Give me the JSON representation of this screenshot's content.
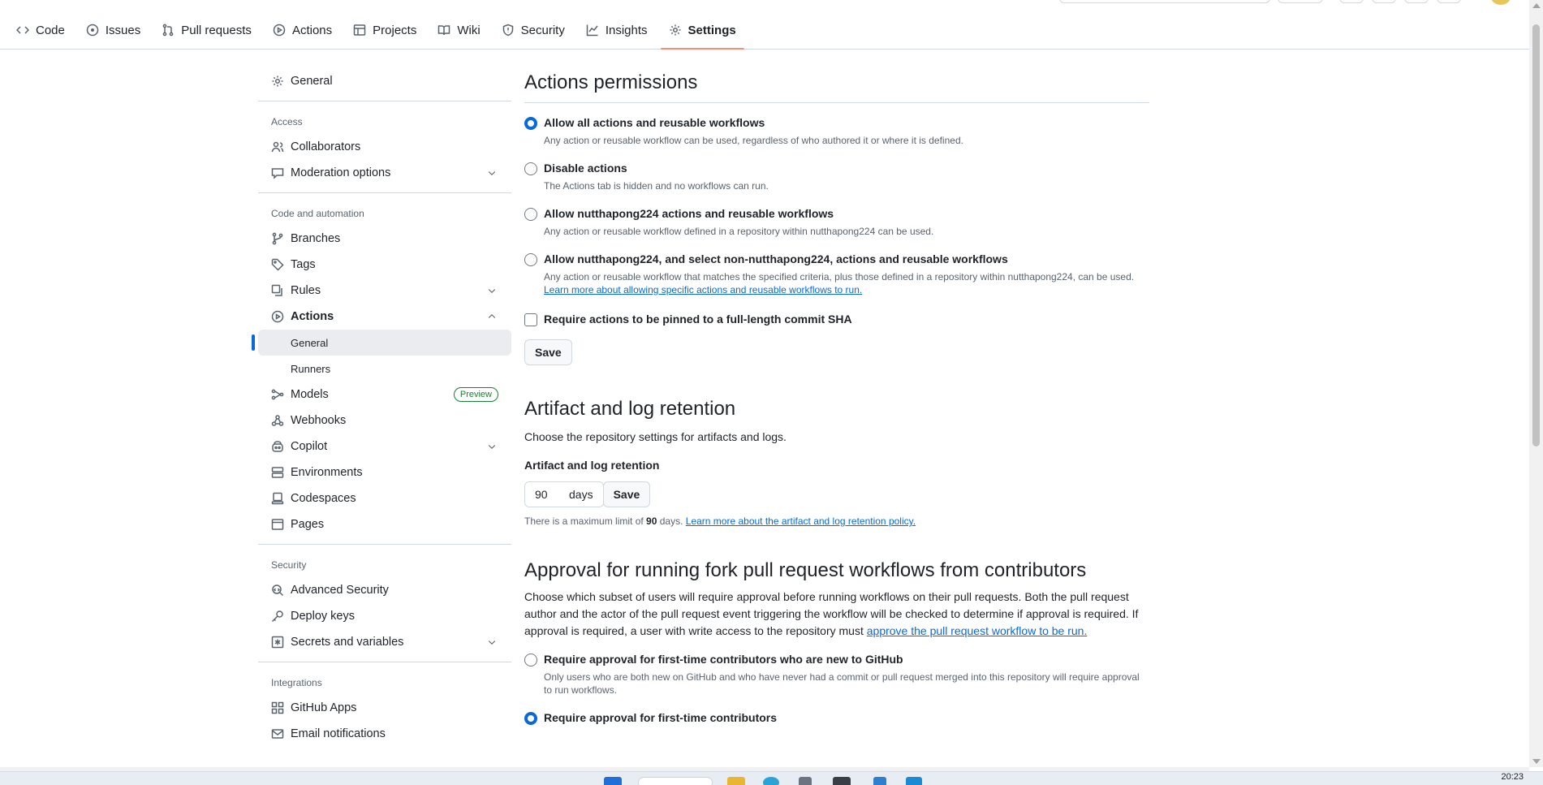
{
  "repo_nav": {
    "tabs": [
      {
        "label": "Code",
        "icon": "code-icon"
      },
      {
        "label": "Issues",
        "icon": "issue-icon"
      },
      {
        "label": "Pull requests",
        "icon": "pull-request-icon"
      },
      {
        "label": "Actions",
        "icon": "play-icon"
      },
      {
        "label": "Projects",
        "icon": "table-icon"
      },
      {
        "label": "Wiki",
        "icon": "book-icon"
      },
      {
        "label": "Security",
        "icon": "shield-icon"
      },
      {
        "label": "Insights",
        "icon": "graph-icon"
      },
      {
        "label": "Settings",
        "icon": "gear-icon",
        "active": true
      }
    ]
  },
  "sidebar": {
    "general": "General",
    "access_heading": "Access",
    "collaborators": "Collaborators",
    "moderation": "Moderation options",
    "code_heading": "Code and automation",
    "branches": "Branches",
    "tags": "Tags",
    "rules": "Rules",
    "actions": "Actions",
    "actions_general": "General",
    "actions_runners": "Runners",
    "models": "Models",
    "models_badge": "Preview",
    "webhooks": "Webhooks",
    "copilot": "Copilot",
    "environments": "Environments",
    "codespaces": "Codespaces",
    "pages": "Pages",
    "security_heading": "Security",
    "advanced_security": "Advanced Security",
    "deploy_keys": "Deploy keys",
    "secrets": "Secrets and variables",
    "integrations_heading": "Integrations",
    "github_apps": "GitHub Apps",
    "email_notifications": "Email notifications"
  },
  "permissions": {
    "title": "Actions permissions",
    "options": [
      {
        "title": "Allow all actions and reusable workflows",
        "desc": "Any action or reusable workflow can be used, regardless of who authored it or where it is defined.",
        "checked": true
      },
      {
        "title": "Disable actions",
        "desc": "The Actions tab is hidden and no workflows can run.",
        "checked": false
      },
      {
        "title": "Allow nutthapong224 actions and reusable workflows",
        "desc": "Any action or reusable workflow defined in a repository within nutthapong224 can be used.",
        "checked": false
      },
      {
        "title": "Allow nutthapong224, and select non-nutthapong224, actions and reusable workflows",
        "desc": "Any action or reusable workflow that matches the specified criteria, plus those defined in a repository within nutthapong224, can be used.",
        "link": "Learn more about allowing specific actions and reusable workflows to run.",
        "checked": false
      }
    ],
    "require_sha": "Require actions to be pinned to a full-length commit SHA",
    "save": "Save"
  },
  "retention": {
    "title": "Artifact and log retention",
    "desc": "Choose the repository settings for artifacts and logs.",
    "label": "Artifact and log retention",
    "value": "90",
    "unit": "days",
    "save": "Save",
    "note_prefix": "There is a maximum limit of",
    "note_value": "90",
    "note_suffix": "days.",
    "note_link": "Learn more about the artifact and log retention policy."
  },
  "approval": {
    "title": "Approval for running fork pull request workflows from contributors",
    "desc": "Choose which subset of users will require approval before running workflows on their pull requests. Both the pull request author and the actor of the pull request event triggering the workflow will be checked to determine if approval is required. If approval is required, a user with write access to the repository must",
    "desc_link": "approve the pull request workflow to be run.",
    "options": [
      {
        "title": "Require approval for first-time contributors who are new to GitHub",
        "desc": "Only users who are both new on GitHub and who have never had a commit or pull request merged into this repository will require approval to run workflows.",
        "checked": false
      },
      {
        "title": "Require approval for first-time contributors",
        "checked": true
      }
    ]
  },
  "taskbar": {
    "time": "20:23"
  }
}
